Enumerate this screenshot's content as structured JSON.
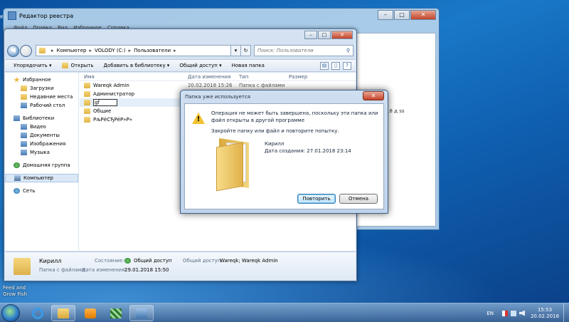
{
  "desktop": {
    "left_label": "Ка",
    "feed_label_1": "Feed and",
    "feed_label_2": "Grow Fish"
  },
  "regedit": {
    "title": "Редактор реестра",
    "menu": [
      "Файл",
      "Правка",
      "Вид",
      "Избранное",
      "Справка"
    ],
    "side_text": "18 д ss"
  },
  "explorer": {
    "address": [
      "Компьютер",
      "VOLODY (C:)",
      "Пользователи"
    ],
    "search_placeholder": "Поиск: Пользователи",
    "toolbar": [
      "Упорядочить ▾",
      "Открыть",
      "Добавить в библиотеку ▾",
      "Общий доступ ▾",
      "Новая папка"
    ],
    "nav": {
      "favorites": "Избранное",
      "fav_items": [
        "Загрузки",
        "Недавние места",
        "Рабочий стол"
      ],
      "libraries": "Библиотеки",
      "lib_items": [
        "Видео",
        "Документы",
        "Изображения",
        "Музыка"
      ],
      "homegroup": "Домашняя группа",
      "computer": "Компьютер",
      "network": "Сеть"
    },
    "columns": [
      "Имя",
      "Дата изменения",
      "Тип",
      "Размер"
    ],
    "rows": [
      {
        "name": "Wareqk Admin",
        "date": "20.02.2018 15:26",
        "type": "Папка с файлами"
      },
      {
        "name": "Администратор",
        "date": "",
        "type": ""
      },
      {
        "name": "gf",
        "date": "",
        "type": ""
      },
      {
        "name": "Общие",
        "date": "",
        "type": ""
      },
      {
        "name": "РљРёСЂРёР»Р»",
        "date": "",
        "type": ""
      }
    ],
    "details": {
      "name": "Кирилл",
      "kind": "Папка с файлами",
      "state_label": "Состояние:",
      "state_value": "Общий доступ",
      "modified_label": "Дата изменения:",
      "modified_value": "29.01.2018 15:50",
      "share_label": "Общий доступ:",
      "share_value": "Wareqk; Wareqk Admin"
    }
  },
  "dialog": {
    "title": "Папка уже используется",
    "message": "Операция не может быть завершена, поскольку эти папка или файл открыты в другой программе",
    "hint": "Закройте папку или файл и повторите попытку.",
    "item_name": "Кирилл",
    "item_created": "Дата создания: 27.01.2018 23:14",
    "retry": "Повторить",
    "cancel": "Отмена"
  },
  "taskbar": {
    "lang": "EN",
    "time": "15:53",
    "date": "20.02.2018"
  }
}
